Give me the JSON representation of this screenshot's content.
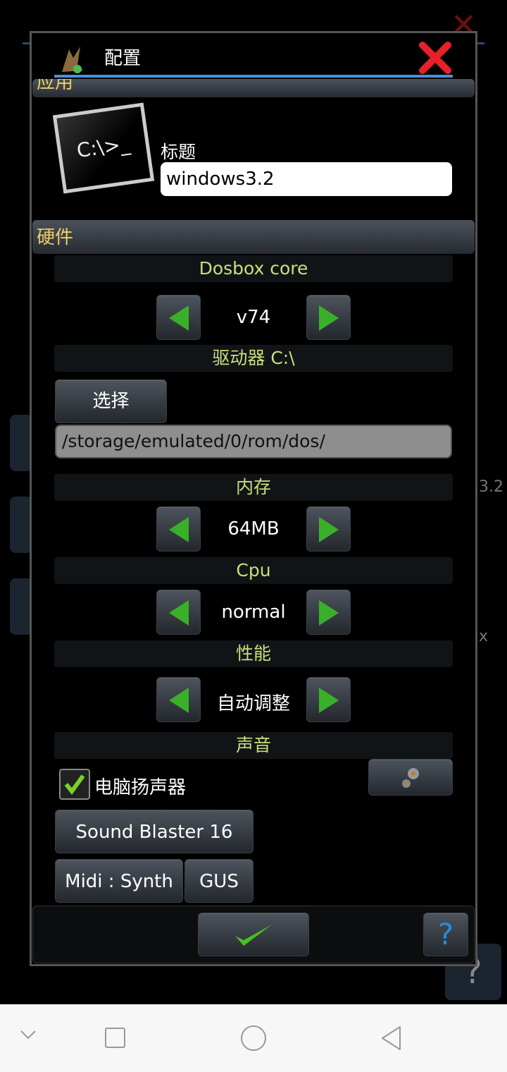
{
  "dialog": {
    "title": "配置",
    "close_icon": "red-x-icon"
  },
  "sections": {
    "app": "应用",
    "hardware": "硬件"
  },
  "app": {
    "title_label": "标题",
    "title_value": "windows3.2"
  },
  "hardware": {
    "core_label": "Dosbox core",
    "core_value": "v74",
    "drive_label": "驱动器 C:\\",
    "select_button": "选择",
    "drive_path": "/storage/emulated/0/rom/dos/",
    "memory_label": "内存",
    "memory_value": "64MB",
    "cpu_label": "Cpu",
    "cpu_value": "normal",
    "perf_label": "性能",
    "perf_value": "自动调整",
    "sound_label": "声音",
    "pc_speaker_label": "电脑扬声器",
    "pc_speaker_checked": true,
    "soundcard_button": "Sound Blaster 16",
    "midi_button": "Midi : Synth",
    "gus_button": "GUS"
  },
  "footer": {
    "help": "?"
  },
  "background": {
    "item1": "3.2",
    "item2": "x",
    "help": "?"
  },
  "colors": {
    "accent": "#4a90d9",
    "section_text": "#f0d060",
    "label_text": "#c8e07a",
    "close": "#e8202a"
  }
}
